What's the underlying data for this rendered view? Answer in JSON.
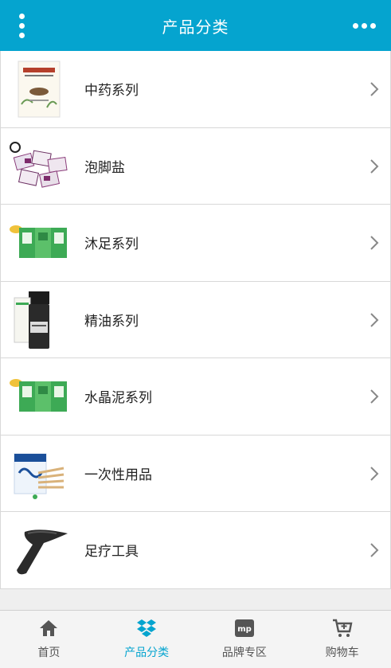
{
  "header": {
    "title": "产品分类"
  },
  "categories": [
    {
      "label": "中药系列",
      "icon": "herbal-book-product"
    },
    {
      "label": "泡脚盐",
      "icon": "foot-soak-salt-packets"
    },
    {
      "label": "沐足系列",
      "icon": "green-foot-bath-packets"
    },
    {
      "label": "精油系列",
      "icon": "essential-oil-bottle"
    },
    {
      "label": "水晶泥系列",
      "icon": "green-crystal-mud-packets"
    },
    {
      "label": "一次性用品",
      "icon": "disposable-supplies-pack"
    },
    {
      "label": "足疗工具",
      "icon": "foot-massage-tool"
    }
  ],
  "tabbar": {
    "items": [
      {
        "label": "首页",
        "icon": "home-icon",
        "active": false
      },
      {
        "label": "产品分类",
        "icon": "dropbox-icon",
        "active": true
      },
      {
        "label": "品牌专区",
        "icon": "mp-icon",
        "active": false
      },
      {
        "label": "购物车",
        "icon": "cart-icon",
        "active": false
      }
    ]
  },
  "colors": {
    "accent": "#05a4cf",
    "background": "#efefef"
  }
}
